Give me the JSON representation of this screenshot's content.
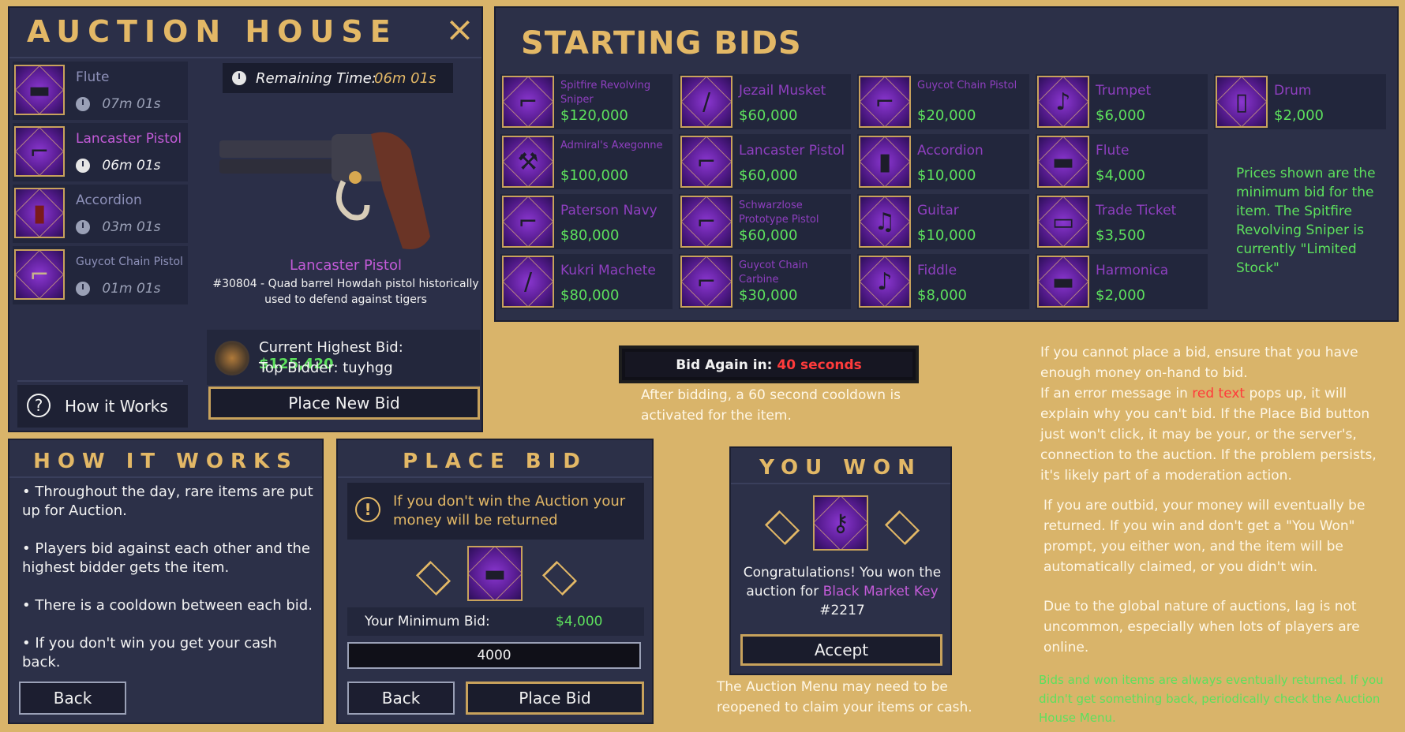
{
  "auction_house": {
    "title": "AUCTION HOUSE",
    "close_icon": "×",
    "items": [
      {
        "name": "Flute",
        "time": "07m 01s"
      },
      {
        "name": "Lancaster Pistol",
        "time": "06m 01s"
      },
      {
        "name": "Accordion",
        "time": "03m 01s"
      },
      {
        "name": "Guycot Chain Pistol",
        "time": "01m 01s"
      }
    ],
    "remaining_label": "Remaining Time:",
    "remaining_value": "06m 01s",
    "item_name": "Lancaster Pistol",
    "item_desc": "#30804 - Quad barrel Howdah pistol historically used to defend against tigers",
    "highest_bid_label": "Current Highest Bid:",
    "highest_bid_value": "$125,420",
    "top_bidder_label": "Top Bidder: tuyhgg",
    "how_it_works_label": "How it Works",
    "place_new_bid_label": "Place New Bid"
  },
  "starting_bids": {
    "title": "STARTING BIDS",
    "items": [
      {
        "name": "Spitfire Revolving Sniper",
        "price": "$120,000",
        "small": true
      },
      {
        "name": "Jezail Musket",
        "price": "$60,000",
        "small": false
      },
      {
        "name": "Guycot Chain Pistol",
        "price": "$20,000",
        "small": true
      },
      {
        "name": "Trumpet",
        "price": "$6,000",
        "small": false
      },
      {
        "name": "Drum",
        "price": "$2,000",
        "small": false
      },
      {
        "name": "Admiral's Axegonne",
        "price": "$100,000",
        "small": true
      },
      {
        "name": "Lancaster Pistol",
        "price": "$60,000",
        "small": false
      },
      {
        "name": "Accordion",
        "price": "$10,000",
        "small": false
      },
      {
        "name": "Flute",
        "price": "$4,000",
        "small": false
      },
      {
        "name": "Paterson Navy",
        "price": "$80,000",
        "small": false
      },
      {
        "name": "Schwarzlose Prototype Pistol",
        "price": "$60,000",
        "small": true
      },
      {
        "name": "Guitar",
        "price": "$10,000",
        "small": false
      },
      {
        "name": "Trade Ticket",
        "price": "$3,500",
        "small": false
      },
      {
        "name": "Kukri Machete",
        "price": "$80,000",
        "small": false
      },
      {
        "name": "Guycot Chain Carbine",
        "price": "$30,000",
        "small": true
      },
      {
        "name": "Fiddle",
        "price": "$8,000",
        "small": false
      },
      {
        "name": "Harmonica",
        "price": "$2,000",
        "small": false
      }
    ],
    "note": "Prices shown are the minimum bid for the item. The Spitfire Revolving Sniper is currently \"Limited Stock\""
  },
  "cooldown": {
    "label": "Bid Again in:",
    "value": "40 seconds",
    "caption": "After bidding, a 60 second cooldown is activated for the item."
  },
  "how_it_works": {
    "title": "HOW IT WORKS",
    "bullets": [
      "• Throughout the day, rare items are put up for Auction.",
      "• Players bid against each other and the highest bidder gets the item.",
      "• There is a cooldown between each bid.",
      "• If you don't win you get your cash back."
    ],
    "back_label": "Back"
  },
  "place_bid": {
    "title": "PLACE BID",
    "warning": "If you don't win the Auction your money will be returned",
    "min_bid_label": "Your Minimum Bid:",
    "min_bid_value": "$4,000",
    "input_value": "4000",
    "back_label": "Back",
    "place_label": "Place Bid"
  },
  "you_won": {
    "title": "YOU WON",
    "message_prefix": "Congratulations! You won the auction for",
    "item_name": "Black Market Key",
    "item_number": "#2217",
    "accept_label": "Accept",
    "caption": "The Auction Menu may need to be reopened to claim your items or cash."
  },
  "notes": {
    "p1_a": "If you cannot place a bid, ensure that you have enough money on-hand to bid.",
    "p1_b_prefix": "If an error message in",
    "p1_b_red": "red text",
    "p1_b_suffix": "pops up, it will explain why you can't bid. If the Place Bid button just won't click, it may be your, or the server's, connection to the auction. If the problem persists, it's likely part of a moderation action.",
    "p2": "If you are outbid, your money will eventually be returned. If you win and don't get a \"You Won\" prompt, you either won, and the item will be automatically claimed, or you didn't win.",
    "p3": "Due to the global nature of auctions, lag is not uncommon, especially when lots of players are online.",
    "p4": "Bids and won items are always eventually returned. If you didn't get something back, periodically check the Auction House Menu."
  },
  "colors": {
    "gold": "#e3b866",
    "green": "#5de05d",
    "purple": "#c35bd8",
    "red": "#ff3b3b",
    "background": "#d9b46a"
  }
}
